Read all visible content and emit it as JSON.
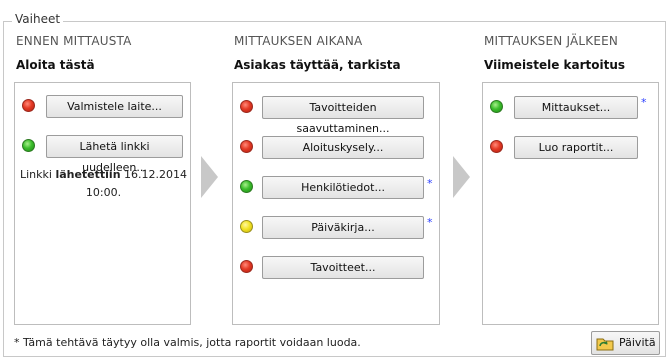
{
  "group_title": "Vaiheet",
  "columns": [
    {
      "heading": "ENNEN MITTAUSTA",
      "subheading": "Aloita tästä",
      "items": [
        {
          "status": "red",
          "label": "Valmistele laite..."
        },
        {
          "status": "green",
          "label": "Lähetä linkki uudelleen..."
        }
      ],
      "note": {
        "prefix": "Linkki ",
        "bold": "lähetettiin",
        "suffix": " 16.12.2014",
        "line2": "10:00."
      }
    },
    {
      "heading": "MITTAUKSEN AIKANA",
      "subheading": "Asiakas täyttää, tarkista",
      "items": [
        {
          "status": "red",
          "label": "Tavoitteiden saavuttaminen..."
        },
        {
          "status": "red",
          "label": "Aloituskysely..."
        },
        {
          "status": "green",
          "label": "Henkilötiedot...",
          "required": "*"
        },
        {
          "status": "yellow",
          "label": "Päiväkirja...",
          "required": "*"
        },
        {
          "status": "red",
          "label": "Tavoitteet..."
        }
      ]
    },
    {
      "heading": "MITTAUKSEN JÄLKEEN",
      "subheading": "Viimeistele kartoitus",
      "items": [
        {
          "status": "green",
          "label": "Mittaukset...",
          "required": "*"
        },
        {
          "status": "red",
          "label": "Luo raportit..."
        }
      ]
    }
  ],
  "footnote": "* Tämä tehtävä täytyy olla valmis, jotta raportit voidaan luoda.",
  "refresh_button": {
    "label": "Päivitä",
    "icon": "refresh-folder-icon"
  },
  "status_colors": {
    "red": "#e53a25",
    "green": "#3cbe2c",
    "yellow": "#f3e325"
  }
}
